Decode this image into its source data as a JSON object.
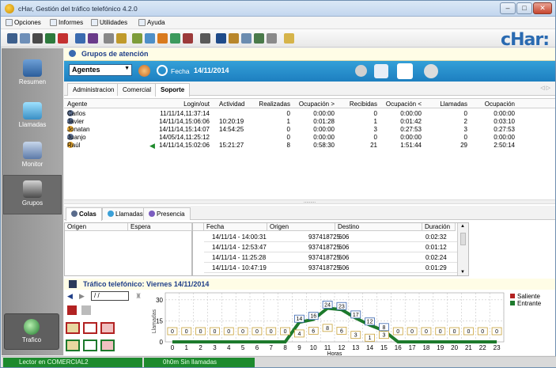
{
  "window": {
    "title": "cHar, Gestión del tráfico telefónico 4.2.0",
    "controls": [
      "–",
      "□",
      "✕"
    ]
  },
  "menu": [
    {
      "label": "Opciones"
    },
    {
      "label": "Informes"
    },
    {
      "label": "Utilidades"
    },
    {
      "label": "Ayuda"
    }
  ],
  "logo": "cHar:",
  "sidebar": [
    {
      "label": "Resumen"
    },
    {
      "label": "Llamadas"
    },
    {
      "label": "Monitor"
    },
    {
      "label": "Grupos"
    },
    {
      "label": "Trafico"
    }
  ],
  "group_header": "Grupos de atención",
  "toolbar2": {
    "combo": "Agentes",
    "fecha_label": "Fecha",
    "fecha_value": "14/11/2014"
  },
  "tabs_top": [
    {
      "label": "Administracion"
    },
    {
      "label": "Comercial"
    },
    {
      "label": "Soporte"
    }
  ],
  "agents_table": {
    "columns": [
      "Agente",
      "Login/out",
      "Actividad",
      "Realizadas",
      "Ocupación >",
      "Recibidas",
      "Ocupación <",
      "Llamadas",
      "Ocupación"
    ],
    "rows": [
      {
        "agente": "Carlos",
        "login": "11/11/14,11:37:14",
        "actividad": "",
        "realizadas": "0",
        "ocup_out": "0:00:00",
        "recibidas": "0",
        "ocup_in": "0:00:00",
        "llamadas": "0",
        "ocup": "0:00:00"
      },
      {
        "agente": "Javier",
        "login": "14/11/14,15:06:06",
        "actividad": "10:20:19",
        "realizadas": "1",
        "ocup_out": "0:01:28",
        "recibidas": "1",
        "ocup_in": "0:01:42",
        "llamadas": "2",
        "ocup": "0:03:10"
      },
      {
        "agente": "Jonatan",
        "login": "14/11/14,15:14:07",
        "actividad": "14:54:25",
        "realizadas": "0",
        "ocup_out": "0:00:00",
        "recibidas": "3",
        "ocup_in": "0:27:53",
        "llamadas": "3",
        "ocup": "0:27:53"
      },
      {
        "agente": "Juanjo",
        "login": "14/05/14,11:25:12",
        "actividad": "",
        "realizadas": "0",
        "ocup_out": "0:00:00",
        "recibidas": "0",
        "ocup_in": "0:00:00",
        "llamadas": "0",
        "ocup": "0:00:00"
      },
      {
        "agente": "Raúl",
        "login": "14/11/14,15:02:06",
        "actividad": "15:21:27",
        "realizadas": "8",
        "ocup_out": "0:58:30",
        "recibidas": "21",
        "ocup_in": "1:51:44",
        "llamadas": "29",
        "ocup": "2:50:14"
      }
    ]
  },
  "tabs_bottom": [
    {
      "label": "Colas"
    },
    {
      "label": "Llamadas"
    },
    {
      "label": "Presencia"
    }
  ],
  "queue_table": {
    "columns": [
      "Origen",
      "Espera"
    ]
  },
  "calls_table": {
    "columns": [
      "Fecha",
      "Origen",
      "Destino",
      "Duración"
    ],
    "rows": [
      {
        "fecha": "14/11/14 - 14:00:31",
        "origen": "937418725",
        "destino": "606",
        "duracion": "0:02:32"
      },
      {
        "fecha": "14/11/14 - 12:53:47",
        "origen": "937418725",
        "destino": "606",
        "duracion": "0:01:12"
      },
      {
        "fecha": "14/11/14 - 11:25:28",
        "origen": "937418725",
        "destino": "606",
        "duracion": "0:02:24"
      },
      {
        "fecha": "14/11/14 - 10:47:19",
        "origen": "937418725",
        "destino": "606",
        "duracion": "0:01:29"
      }
    ]
  },
  "traffic_header": "Tráfico telefónico: Viernes 14/11/2014",
  "date_input": "/ /",
  "chart_data": {
    "type": "bar",
    "x": [
      "0",
      "1",
      "2",
      "3",
      "4",
      "5",
      "6",
      "7",
      "8",
      "9",
      "10",
      "11",
      "12",
      "13",
      "14",
      "15",
      "16",
      "17",
      "18",
      "19",
      "20",
      "21",
      "22",
      "23"
    ],
    "xlabel": "Horas",
    "ylabel": "Llamadas",
    "yticks": [
      "30",
      "15",
      "0"
    ],
    "ylim": [
      0,
      35
    ],
    "legend_position": "right",
    "series": [
      {
        "name": "Saliente",
        "color": "#b22222",
        "values": [
          0,
          0,
          0,
          0,
          0,
          0,
          0,
          0,
          0,
          4,
          6,
          8,
          6,
          3,
          1,
          3,
          0,
          0,
          0,
          0,
          0,
          0,
          0,
          0
        ]
      },
      {
        "name": "Entrante",
        "color": "#1d7a2c",
        "values": [
          0,
          0,
          0,
          0,
          0,
          0,
          0,
          0,
          0,
          14,
          16,
          24,
          23,
          17,
          12,
          8,
          0,
          0,
          0,
          0,
          0,
          0,
          0,
          0
        ]
      }
    ]
  },
  "status": {
    "left": "Lector en COMERCIAL2",
    "right": "0h0m Sin llamadas"
  },
  "colors": {
    "bluebar": "#2a90cf",
    "status_green": "#1d8a2d",
    "header_text": "#1f3e88"
  }
}
